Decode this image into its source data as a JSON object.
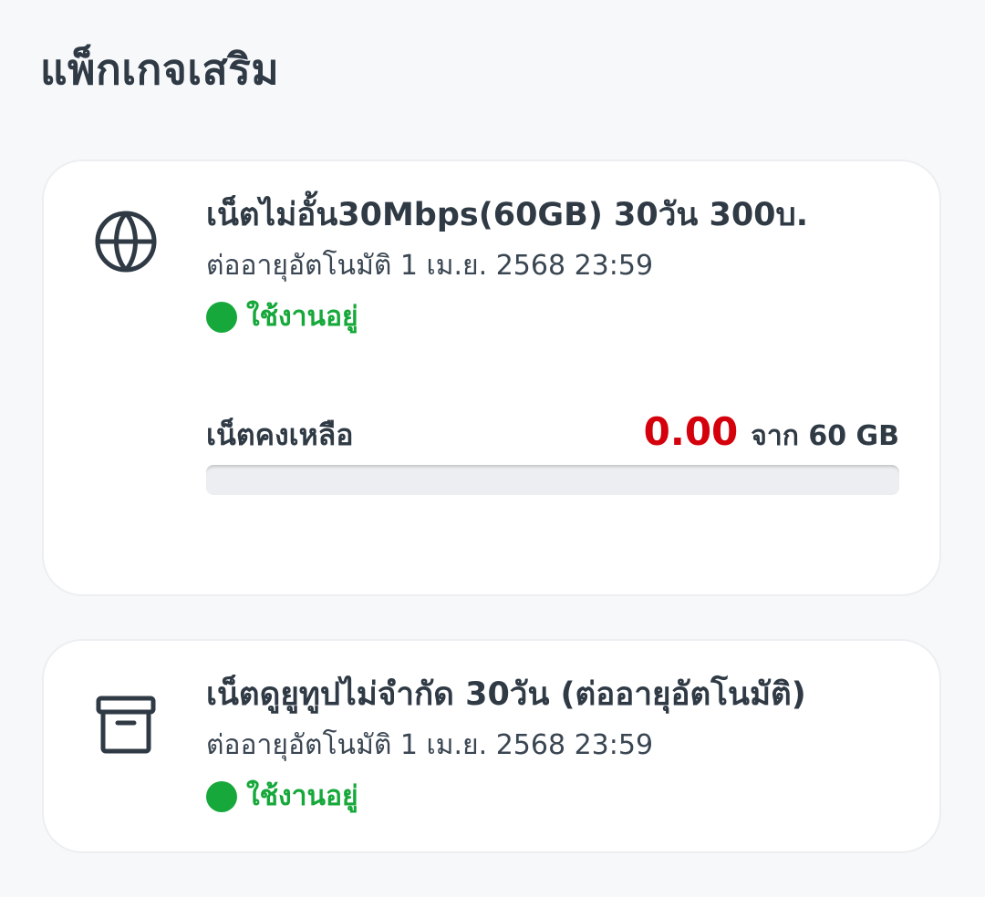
{
  "section": {
    "title": "แพ็กเกจเสริม"
  },
  "colors": {
    "active": "#16a83a",
    "remaining": "#d4000b",
    "text": "#2f3a45",
    "track": "#eceef1"
  },
  "packages": [
    {
      "icon": "globe-icon",
      "name": "เน็ตไม่อั้น30Mbps(60GB) 30วัน 300บ.",
      "renewal": "ต่ออายุอัตโนมัติ 1 เม.ย. 2568 23:59",
      "status": "ใช้งานอยู่",
      "usage": {
        "label": "เน็ตคงเหลือ",
        "remaining": "0.00",
        "total_text": "จาก 60 GB",
        "remaining_fraction": 0.0
      }
    },
    {
      "icon": "archive-box-icon",
      "name": "เน็ตดูยูทูปไม่จำกัด 30วัน (ต่ออายุอัตโนมัติ)",
      "renewal": "ต่ออายุอัตโนมัติ 1 เม.ย. 2568 23:59",
      "status": "ใช้งานอยู่"
    }
  ]
}
